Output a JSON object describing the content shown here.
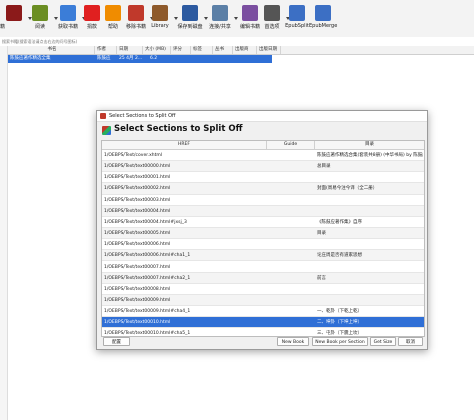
{
  "toolbar": {
    "items": [
      {
        "label": "加书籍",
        "color": "#8b1a1a",
        "icon": "add-books-icon"
      },
      {
        "label": "阅读",
        "color": "#6b8e23",
        "icon": "view-book-icon"
      },
      {
        "label": "获取书籍",
        "color": "#3b7dd8",
        "icon": "fetch-news-icon"
      },
      {
        "label": "捐款",
        "color": "#e02020",
        "icon": "donate-heart-icon"
      },
      {
        "label": "帮助",
        "color": "#f08c00",
        "icon": "help-icon"
      },
      {
        "label": "移除书籍",
        "color": "#c0392b",
        "icon": "remove-books-icon"
      },
      {
        "label": "Library",
        "color": "#8e5a2b",
        "icon": "library-icon"
      },
      {
        "label": "保存到磁盘",
        "color": "#2c5aa0",
        "icon": "save-to-disk-icon"
      },
      {
        "label": "连接/共享",
        "color": "#5b7fa6",
        "icon": "connect-share-icon"
      },
      {
        "label": "编辑书籍",
        "color": "#7b4fa0",
        "icon": "edit-book-icon"
      },
      {
        "label": "首选项",
        "color": "#555555",
        "icon": "preferences-icon"
      },
      {
        "label": "EpubSplit",
        "color": "#3c6fc4",
        "icon": "epubsplit-icon"
      },
      {
        "label": "EpubMerge",
        "color": "#3c6fc4",
        "icon": "epubmerge-icon"
      }
    ]
  },
  "search": {
    "placeholder": "搜索书籍(搜索语法请点击右边的问号图标)"
  },
  "booklist": {
    "headers": [
      "书名",
      "作者",
      "日期",
      "大小 (MB)",
      "评分",
      "标签",
      "丛书",
      "出版商",
      "出版日期"
    ],
    "row": {
      "title": "陈鼓应著作精选全集",
      "author": "陈鼓应",
      "date": "25 4月 2...",
      "size": "6.2"
    }
  },
  "dialog": {
    "window_title": "Select Sections to Split Off",
    "heading": "Select Sections to Split Off",
    "columns": [
      "HREF",
      "Guide",
      "目录"
    ],
    "rows": [
      {
        "href": "1/OEBPS/Text/cover.xhtml",
        "guide": "",
        "toc": "陈鼓应著作精选合集(套装共8册) (中华书局) by 陈鼓应"
      },
      {
        "href": "1/OEBPS/Text/text00000.html",
        "guide": "",
        "toc": "总目录"
      },
      {
        "href": "1/OEBPS/Text/text00001.html",
        "guide": "",
        "toc": ""
      },
      {
        "href": "1/OEBPS/Text/text00002.html",
        "guide": "",
        "toc": "封面(周易今注今译（全二册）"
      },
      {
        "href": "1/OEBPS/Text/text00003.html",
        "guide": "",
        "toc": ""
      },
      {
        "href": "1/OEBPS/Text/text00004.html",
        "guide": "",
        "toc": ""
      },
      {
        "href": "1/OEBPS/Text/text00004.html#jxsj_3",
        "guide": "",
        "toc": "《陈鼓应著作集》自序"
      },
      {
        "href": "1/OEBPS/Text/text00005.html",
        "guide": "",
        "toc": "目录"
      },
      {
        "href": "1/OEBPS/Text/text00006.html",
        "guide": "",
        "toc": ""
      },
      {
        "href": "1/OEBPS/Text/text00006.html#cha1_1",
        "guide": "",
        "toc": "论庄周是否有道家思想"
      },
      {
        "href": "1/OEBPS/Text/text00007.html",
        "guide": "",
        "toc": ""
      },
      {
        "href": "1/OEBPS/Text/text00007.html#cha2_1",
        "guide": "",
        "toc": "前言"
      },
      {
        "href": "1/OEBPS/Text/text00008.html",
        "guide": "",
        "toc": ""
      },
      {
        "href": "1/OEBPS/Text/text00009.html",
        "guide": "",
        "toc": ""
      },
      {
        "href": "1/OEBPS/Text/text00009.html#cha4_1",
        "guide": "",
        "toc": "一、乾卦（下乾上乾）"
      },
      {
        "href": "1/OEBPS/Text/text00010.html",
        "guide": "",
        "toc": "二、坤卦（下坤上坤）"
      },
      {
        "href": "1/OEBPS/Text/text00010.html#cha5_1",
        "guide": "",
        "toc": "三、屯卦（下震上坎）"
      }
    ],
    "selected_row": 15,
    "buttons": {
      "left": "配置",
      "new_book": "New Book",
      "new_book_per_section": "New Book per Section",
      "get_size": "Get Size",
      "cancel": "取消"
    }
  }
}
